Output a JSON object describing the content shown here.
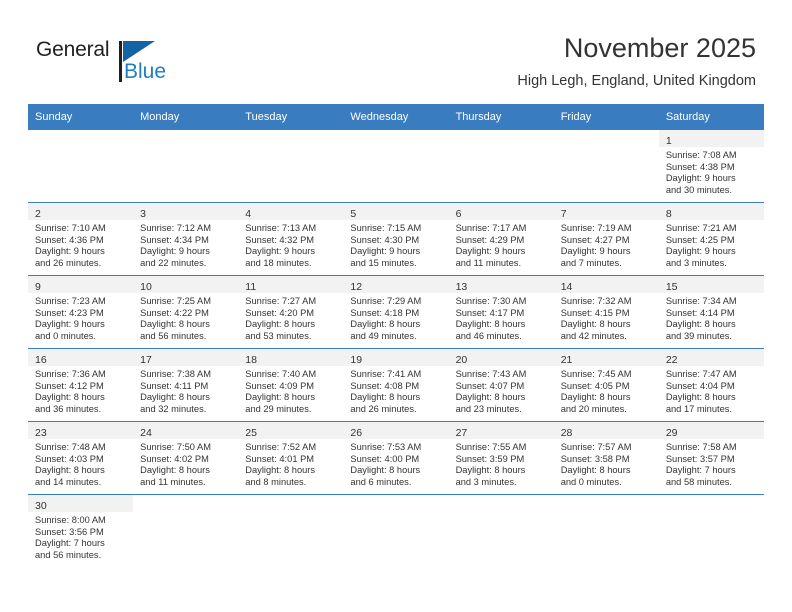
{
  "brand": {
    "name_part1": "General",
    "name_part2": "Blue",
    "accent_color": "#1f7ec4",
    "flag_color": "#1464a5"
  },
  "header": {
    "title": "November 2025",
    "subtitle": "High Legh, England, United Kingdom",
    "header_bg": "#3a7cc0",
    "daynum_bg": "#f2f2f2"
  },
  "weekdays": [
    "Sunday",
    "Monday",
    "Tuesday",
    "Wednesday",
    "Thursday",
    "Friday",
    "Saturday"
  ],
  "weeks": [
    [
      {
        "blank": true
      },
      {
        "blank": true
      },
      {
        "blank": true
      },
      {
        "blank": true
      },
      {
        "blank": true
      },
      {
        "blank": true
      },
      {
        "day": "1",
        "sunrise": "Sunrise: 7:08 AM",
        "sunset": "Sunset: 4:38 PM",
        "daylight1": "Daylight: 9 hours",
        "daylight2": "and 30 minutes."
      }
    ],
    [
      {
        "day": "2",
        "sunrise": "Sunrise: 7:10 AM",
        "sunset": "Sunset: 4:36 PM",
        "daylight1": "Daylight: 9 hours",
        "daylight2": "and 26 minutes."
      },
      {
        "day": "3",
        "sunrise": "Sunrise: 7:12 AM",
        "sunset": "Sunset: 4:34 PM",
        "daylight1": "Daylight: 9 hours",
        "daylight2": "and 22 minutes."
      },
      {
        "day": "4",
        "sunrise": "Sunrise: 7:13 AM",
        "sunset": "Sunset: 4:32 PM",
        "daylight1": "Daylight: 9 hours",
        "daylight2": "and 18 minutes."
      },
      {
        "day": "5",
        "sunrise": "Sunrise: 7:15 AM",
        "sunset": "Sunset: 4:30 PM",
        "daylight1": "Daylight: 9 hours",
        "daylight2": "and 15 minutes."
      },
      {
        "day": "6",
        "sunrise": "Sunrise: 7:17 AM",
        "sunset": "Sunset: 4:29 PM",
        "daylight1": "Daylight: 9 hours",
        "daylight2": "and 11 minutes."
      },
      {
        "day": "7",
        "sunrise": "Sunrise: 7:19 AM",
        "sunset": "Sunset: 4:27 PM",
        "daylight1": "Daylight: 9 hours",
        "daylight2": "and 7 minutes."
      },
      {
        "day": "8",
        "sunrise": "Sunrise: 7:21 AM",
        "sunset": "Sunset: 4:25 PM",
        "daylight1": "Daylight: 9 hours",
        "daylight2": "and 3 minutes."
      }
    ],
    [
      {
        "day": "9",
        "sunrise": "Sunrise: 7:23 AM",
        "sunset": "Sunset: 4:23 PM",
        "daylight1": "Daylight: 9 hours",
        "daylight2": "and 0 minutes."
      },
      {
        "day": "10",
        "sunrise": "Sunrise: 7:25 AM",
        "sunset": "Sunset: 4:22 PM",
        "daylight1": "Daylight: 8 hours",
        "daylight2": "and 56 minutes."
      },
      {
        "day": "11",
        "sunrise": "Sunrise: 7:27 AM",
        "sunset": "Sunset: 4:20 PM",
        "daylight1": "Daylight: 8 hours",
        "daylight2": "and 53 minutes."
      },
      {
        "day": "12",
        "sunrise": "Sunrise: 7:29 AM",
        "sunset": "Sunset: 4:18 PM",
        "daylight1": "Daylight: 8 hours",
        "daylight2": "and 49 minutes."
      },
      {
        "day": "13",
        "sunrise": "Sunrise: 7:30 AM",
        "sunset": "Sunset: 4:17 PM",
        "daylight1": "Daylight: 8 hours",
        "daylight2": "and 46 minutes."
      },
      {
        "day": "14",
        "sunrise": "Sunrise: 7:32 AM",
        "sunset": "Sunset: 4:15 PM",
        "daylight1": "Daylight: 8 hours",
        "daylight2": "and 42 minutes."
      },
      {
        "day": "15",
        "sunrise": "Sunrise: 7:34 AM",
        "sunset": "Sunset: 4:14 PM",
        "daylight1": "Daylight: 8 hours",
        "daylight2": "and 39 minutes."
      }
    ],
    [
      {
        "day": "16",
        "sunrise": "Sunrise: 7:36 AM",
        "sunset": "Sunset: 4:12 PM",
        "daylight1": "Daylight: 8 hours",
        "daylight2": "and 36 minutes."
      },
      {
        "day": "17",
        "sunrise": "Sunrise: 7:38 AM",
        "sunset": "Sunset: 4:11 PM",
        "daylight1": "Daylight: 8 hours",
        "daylight2": "and 32 minutes."
      },
      {
        "day": "18",
        "sunrise": "Sunrise: 7:40 AM",
        "sunset": "Sunset: 4:09 PM",
        "daylight1": "Daylight: 8 hours",
        "daylight2": "and 29 minutes."
      },
      {
        "day": "19",
        "sunrise": "Sunrise: 7:41 AM",
        "sunset": "Sunset: 4:08 PM",
        "daylight1": "Daylight: 8 hours",
        "daylight2": "and 26 minutes."
      },
      {
        "day": "20",
        "sunrise": "Sunrise: 7:43 AM",
        "sunset": "Sunset: 4:07 PM",
        "daylight1": "Daylight: 8 hours",
        "daylight2": "and 23 minutes."
      },
      {
        "day": "21",
        "sunrise": "Sunrise: 7:45 AM",
        "sunset": "Sunset: 4:05 PM",
        "daylight1": "Daylight: 8 hours",
        "daylight2": "and 20 minutes."
      },
      {
        "day": "22",
        "sunrise": "Sunrise: 7:47 AM",
        "sunset": "Sunset: 4:04 PM",
        "daylight1": "Daylight: 8 hours",
        "daylight2": "and 17 minutes."
      }
    ],
    [
      {
        "day": "23",
        "sunrise": "Sunrise: 7:48 AM",
        "sunset": "Sunset: 4:03 PM",
        "daylight1": "Daylight: 8 hours",
        "daylight2": "and 14 minutes."
      },
      {
        "day": "24",
        "sunrise": "Sunrise: 7:50 AM",
        "sunset": "Sunset: 4:02 PM",
        "daylight1": "Daylight: 8 hours",
        "daylight2": "and 11 minutes."
      },
      {
        "day": "25",
        "sunrise": "Sunrise: 7:52 AM",
        "sunset": "Sunset: 4:01 PM",
        "daylight1": "Daylight: 8 hours",
        "daylight2": "and 8 minutes."
      },
      {
        "day": "26",
        "sunrise": "Sunrise: 7:53 AM",
        "sunset": "Sunset: 4:00 PM",
        "daylight1": "Daylight: 8 hours",
        "daylight2": "and 6 minutes."
      },
      {
        "day": "27",
        "sunrise": "Sunrise: 7:55 AM",
        "sunset": "Sunset: 3:59 PM",
        "daylight1": "Daylight: 8 hours",
        "daylight2": "and 3 minutes."
      },
      {
        "day": "28",
        "sunrise": "Sunrise: 7:57 AM",
        "sunset": "Sunset: 3:58 PM",
        "daylight1": "Daylight: 8 hours",
        "daylight2": "and 0 minutes."
      },
      {
        "day": "29",
        "sunrise": "Sunrise: 7:58 AM",
        "sunset": "Sunset: 3:57 PM",
        "daylight1": "Daylight: 7 hours",
        "daylight2": "and 58 minutes."
      }
    ],
    [
      {
        "day": "30",
        "sunrise": "Sunrise: 8:00 AM",
        "sunset": "Sunset: 3:56 PM",
        "daylight1": "Daylight: 7 hours",
        "daylight2": "and 56 minutes."
      },
      {
        "blank": true
      },
      {
        "blank": true
      },
      {
        "blank": true
      },
      {
        "blank": true
      },
      {
        "blank": true
      },
      {
        "blank": true
      }
    ]
  ]
}
